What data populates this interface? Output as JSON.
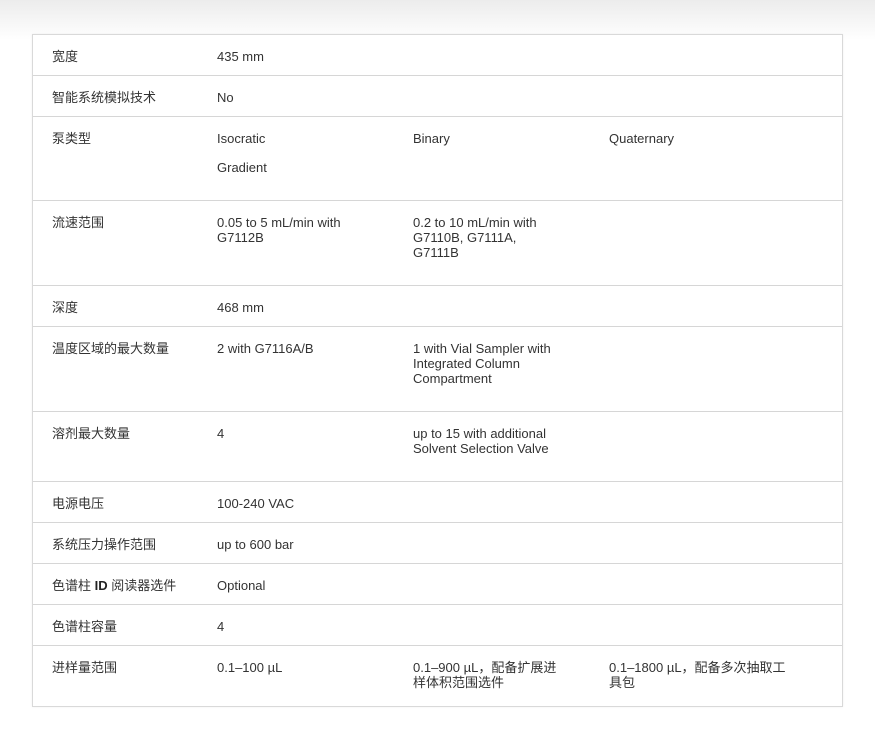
{
  "spec_table": {
    "rows": [
      {
        "label": "宽度",
        "values": [
          "435 mm",
          "",
          ""
        ]
      },
      {
        "label": "智能系统模拟技术",
        "values": [
          "No",
          "",
          ""
        ]
      },
      {
        "label": "泵类型",
        "values": [
          "Isocratic",
          "Binary",
          "Quaternary"
        ],
        "extra": "Gradient"
      },
      {
        "label": "流速范围",
        "values": [
          "0.05 to 5 mL/min with G7112B",
          "0.2 to 10 mL/min with G7110B, G7111A, G7111B",
          ""
        ]
      },
      {
        "label": "深度",
        "values": [
          "468 mm",
          "",
          ""
        ]
      },
      {
        "label": "温度区域的最大数量",
        "values": [
          "2 with G7116A/B",
          "1 with Vial Sampler with Integrated Column Compartment",
          ""
        ]
      },
      {
        "label": "溶剂最大数量",
        "values": [
          "4",
          "up to 15 with additional Solvent Selection Valve",
          ""
        ]
      },
      {
        "label": "电源电压",
        "values": [
          "100-240 VAC",
          "",
          ""
        ]
      },
      {
        "label": "系统压力操作范围",
        "values": [
          "up to 600 bar",
          "",
          ""
        ]
      },
      {
        "label_pre": "色谱柱 ",
        "label_bold": "ID",
        "label_post": " 阅读器选件",
        "values": [
          "Optional",
          "",
          ""
        ]
      },
      {
        "label": "色谱柱容量",
        "values": [
          "4",
          "",
          ""
        ]
      },
      {
        "label": "进样量范围",
        "values": [
          "0.1–100 µL",
          "0.1–900 µL，配备扩展进样体积范围选件",
          "0.1–1800 µL，配备多次抽取工具包"
        ]
      }
    ]
  }
}
